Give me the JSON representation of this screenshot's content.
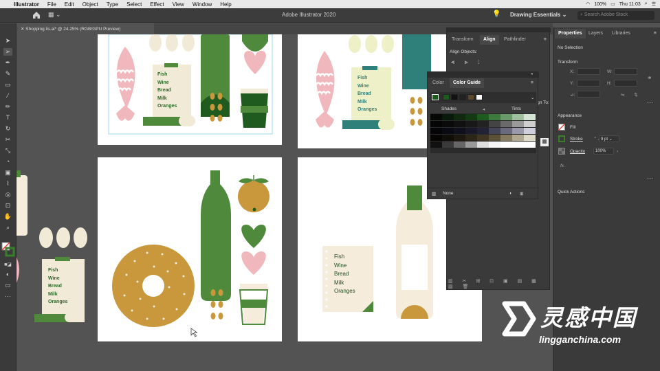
{
  "menubar": {
    "app_name": "Illustrator",
    "items": [
      "File",
      "Edit",
      "Object",
      "Type",
      "Select",
      "Effect",
      "View",
      "Window",
      "Help"
    ],
    "battery": "100%",
    "clock": "Thu 11:03"
  },
  "appbar": {
    "title": "Adobe Illustrator 2020",
    "workspace": "Drawing Essentials",
    "search_placeholder": "Search Adobe Stock"
  },
  "document_tab": {
    "label": "Shopping lis.ai* @ 24.25% (RGB/GPU Preview)"
  },
  "artwork": {
    "list_items": [
      "Fish",
      "Wine",
      "Bread",
      "Milk",
      "Oranges"
    ],
    "colors": {
      "green": "#4f8a3c",
      "dark_green": "#1f5a1f",
      "pink": "#f0b8bc",
      "cream": "#f0ead6",
      "mustard": "#c9983c",
      "teal": "#2f7f7a",
      "lime_cream": "#eef0c8",
      "wine_cream": "#f5ecdc"
    }
  },
  "align_panel": {
    "tabs": [
      "Transform",
      "Align",
      "Pathfinder"
    ],
    "active_tab": "Align",
    "section_label": "Align Objects:",
    "align_to_label": "Align To:"
  },
  "color_guide_panel": {
    "tabs": [
      "Color",
      "Color Guide"
    ],
    "active_tab": "Color Guide",
    "shades_label": "Shades",
    "tints_label": "Tints",
    "footer_label": "None"
  },
  "properties_panel": {
    "tabs": [
      "Properties",
      "Layers",
      "Libraries"
    ],
    "active_tab": "Properties",
    "selection_label": "No Selection",
    "transform_heading": "Transform",
    "x_label": "X:",
    "y_label": "Y:",
    "w_label": "W:",
    "h_label": "H:",
    "angle_label": "⊿:",
    "appearance_heading": "Appearance",
    "fill_label": "Fill",
    "stroke_label": "Stroke",
    "stroke_value": "9 pt",
    "opacity_label": "Opacity",
    "opacity_value": "100%",
    "fx_label": "fx.",
    "quick_actions_heading": "Quick Actions"
  },
  "watermark": {
    "chinese": "灵感中国",
    "url": "lingganchina.com"
  }
}
